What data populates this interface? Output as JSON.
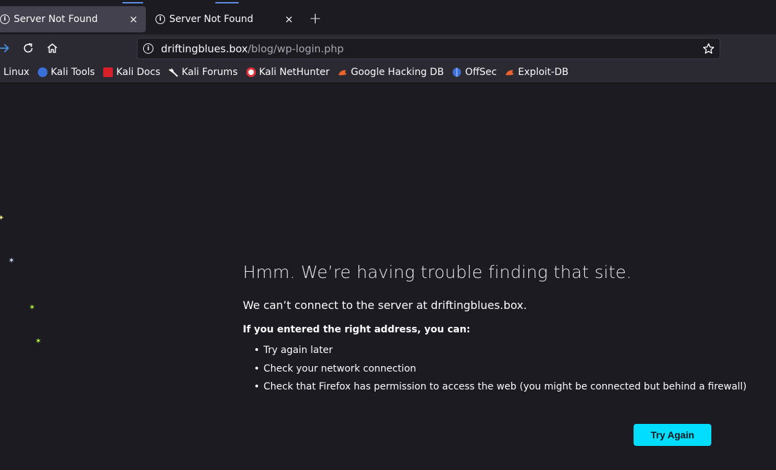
{
  "tabs": [
    {
      "label": "Server Not Found",
      "close": "×",
      "active": true
    },
    {
      "label": "Server Not Found",
      "close": "×",
      "active": false
    }
  ],
  "new_tab": "+",
  "nav": {
    "url_host": "driftingblues.box",
    "url_path": "/blog/wp-login.php"
  },
  "bookmarks": [
    {
      "label": "Linux",
      "icon": "none",
      "color": ""
    },
    {
      "label": "Kali Tools",
      "icon": "kali-tools-icon",
      "color": "#3b6fd8"
    },
    {
      "label": "Kali Docs",
      "icon": "kali-docs-icon",
      "color": "#d8202a"
    },
    {
      "label": "Kali Forums",
      "icon": "kali-forums-icon",
      "color": "#ffffff"
    },
    {
      "label": "Kali NetHunter",
      "icon": "kali-nethunter-icon",
      "color": "#e0303a"
    },
    {
      "label": "Google Hacking DB",
      "icon": "exploit-db-icon",
      "color": "#e8642c"
    },
    {
      "label": "OffSec",
      "icon": "offsec-icon",
      "color": "#3f6fd8"
    },
    {
      "label": "Exploit-DB",
      "icon": "exploit-db-icon",
      "color": "#e8642c"
    }
  ],
  "error": {
    "title": "Hmm. We’re having trouble finding that site.",
    "description": "We can’t connect to the server at driftingblues.box.",
    "lead": "If you entered the right address, you can:",
    "items": [
      "Try again later",
      "Check your network connection",
      "Check that Firefox has permission to access the web (you might be connected but behind a firewall)"
    ],
    "button": "Try Again"
  },
  "colors": {
    "accent": "#00ddff",
    "background": "#1c1b22",
    "toolbar": "#2b2a33"
  }
}
